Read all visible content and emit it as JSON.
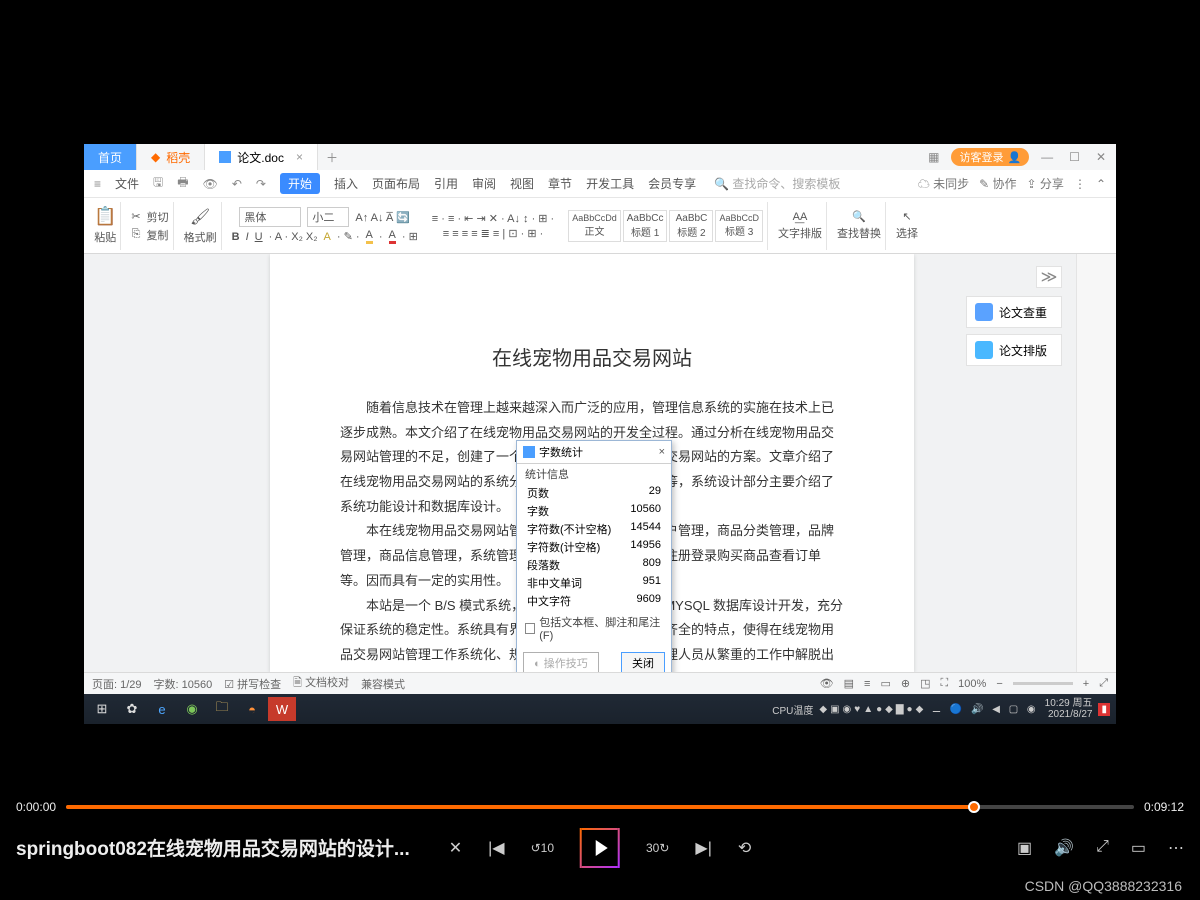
{
  "titlebar": {
    "home": "首页",
    "daoke": "稻壳",
    "doc": "论文.doc",
    "login": "访客登录"
  },
  "menu": {
    "file": "文件",
    "start": "开始",
    "insert": "插入",
    "layout": "页面布局",
    "ref": "引用",
    "review": "审阅",
    "view": "视图",
    "chapter": "章节",
    "dev": "开发工具",
    "vip": "会员专享",
    "searchPlaceholder": "查找命令、搜索模板",
    "unsync": "未同步",
    "coop": "协作",
    "share": "分享"
  },
  "ribbon": {
    "paste": "粘贴",
    "cut": "剪切",
    "copy": "复制",
    "fmt": "格式刷",
    "font": "黑体",
    "size": "小二",
    "body": "正文",
    "h1": "标题 1",
    "h2": "标题 2",
    "h3": "标题 3",
    "textLayout": "文字排版",
    "find": "查找替换",
    "select": "选择"
  },
  "doc": {
    "p1": "随着信息技术在管理上越来越深入而广泛的应用，管理信息系统的实施在技术上已逐步成熟。本文介绍了在线宠物用品交易网站的开发全过程。通过分析在线宠物用品交易网站管理的不足，创建了一个计算机管理在线宠物用品交易网站的方案。文章介绍了在线宠物用品交易网站的系统分析部分，包括可行性分析等，系统设计部分主要介绍了系统功能设计和数据库设计。",
    "p2": "本在线宠物用品交易网站管理员功能有个人中心，用户管理，商品分类管理，品牌管理，商品信息管理，系统管理，订单管理等。用户可以注册登录购买商品查看订单等。因而具有一定的实用性。",
    "p3": "本站是一个 B/S 模式系统，采用 Spring Boot 框架，MYSQL 数据库设计开发，充分保证系统的稳定性。系统具有界面清晰、操作简单，功能齐全的特点，使得在线宠物用品交易网站管理工作系统化、规范化。本系统的使用使管理人员从繁重的工作中解脱出"
  },
  "side": {
    "check": "论文查重",
    "layout": "论文排版"
  },
  "dialog": {
    "title": "字数统计",
    "section": "统计信息",
    "rows": [
      [
        "页数",
        "29"
      ],
      [
        "字数",
        "10560"
      ],
      [
        "字符数(不计空格)",
        "14544"
      ],
      [
        "字符数(计空格)",
        "14956"
      ],
      [
        "段落数",
        "809"
      ],
      [
        "非中文单词",
        "951"
      ],
      [
        "中文字符",
        "9609"
      ]
    ],
    "checkbox": "包括文本框、脚注和尾注(F)",
    "tip": "操作技巧",
    "close": "关闭"
  },
  "status": {
    "page": "页面: 1/29",
    "words": "字数: 10560",
    "spell": "拼写检查",
    "proof": "文档校对",
    "compat": "兼容模式",
    "zoom": "100%"
  },
  "tray": {
    "cpu": "CPU温度",
    "time": "10:29 周五",
    "date": "2021/8/27"
  },
  "player": {
    "cur": "0:00:00",
    "dur": "0:09:12",
    "title": "springboot082在线宠物用品交易网站的设计...",
    "watermark": "CSDN @QQ3888232316"
  }
}
